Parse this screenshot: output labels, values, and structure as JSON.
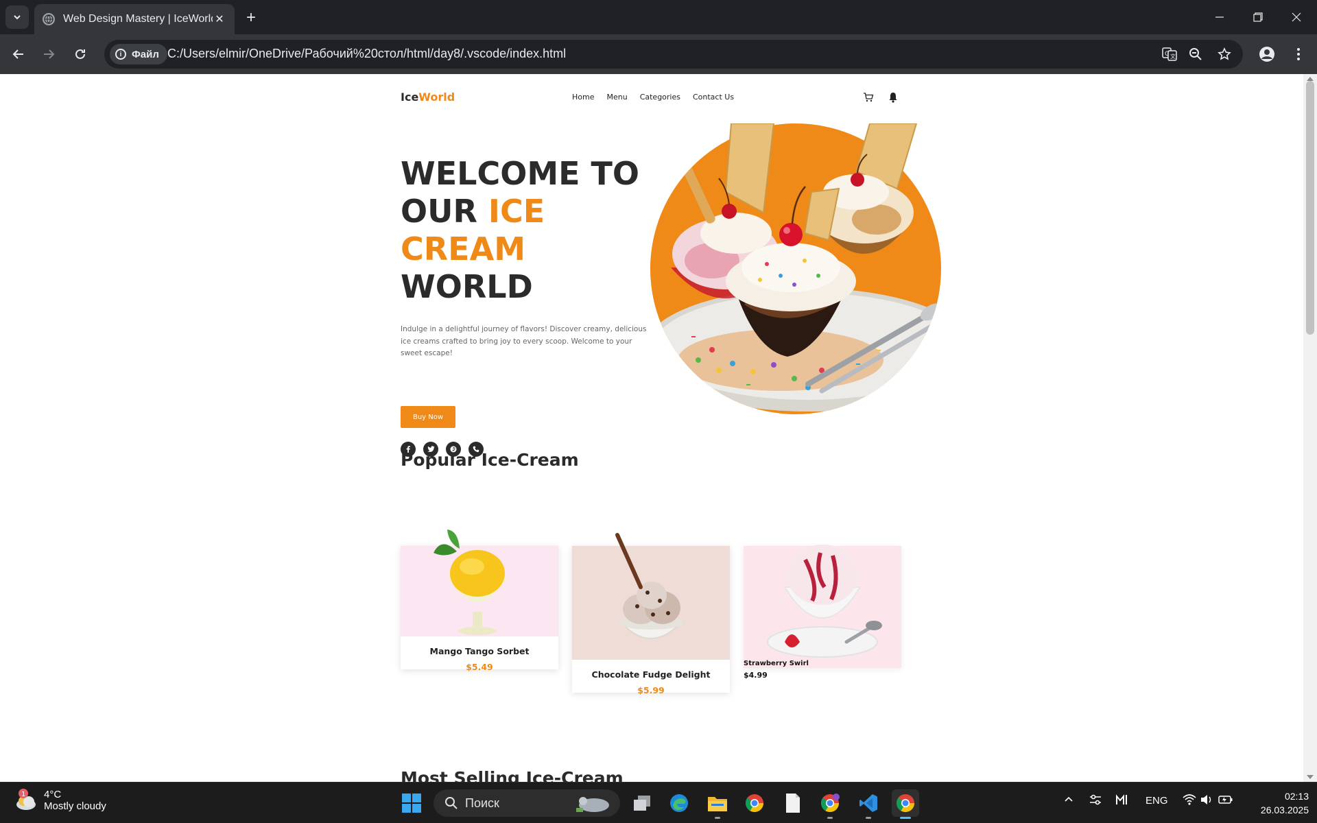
{
  "browser": {
    "tab_title": "Web Design Mastery | IceWorld",
    "site_info_label": "Файл",
    "url": "C:/Users/elmir/OneDrive/Рабочий%20стол/html/day8/.vscode/index.html"
  },
  "site": {
    "logo_part1": "Ice",
    "logo_part2": "World",
    "nav": [
      "Home",
      "Menu",
      "Categories",
      "Contact Us"
    ],
    "hero": {
      "title_line1": "WELCOME TO",
      "title_line2_a": "OUR ",
      "title_line2_b": "ICE CREAM",
      "title_line3": "WORLD",
      "description": "Indulge in a delightful journey of flavors! Discover creamy, delicious ice creams crafted to bring joy to every scoop. Welcome to your sweet escape!",
      "cta": "Buy Now"
    },
    "popular_title": "Popular Ice-Cream",
    "products": [
      {
        "name": "Mango Tango Sorbet",
        "price": "$5.49"
      },
      {
        "name": "Chocolate Fudge Delight",
        "price": "$5.99"
      },
      {
        "name": "Strawberry Swirl",
        "price": "$4.99"
      }
    ],
    "most_selling_title": "Most Selling Ice-Cream"
  },
  "taskbar": {
    "weather_temp": "4°C",
    "weather_cond": "Mostly cloudy",
    "weather_badge": "1",
    "search_placeholder": "Поиск",
    "lang": "ENG",
    "time": "02:13",
    "date": "26.03.2025"
  },
  "colors": {
    "accent": "#ef8a18",
    "dark_text": "#2b2b2b"
  },
  "icons": [
    "tab-list-icon",
    "globe-icon",
    "close-icon",
    "plus-icon",
    "minimize-icon",
    "restore-icon",
    "window-close-icon",
    "back-icon",
    "forward-icon",
    "reload-icon",
    "info-icon",
    "translate-icon",
    "zoom-icon",
    "star-icon",
    "profile-icon",
    "menu-dots-icon",
    "cart-icon",
    "bell-icon",
    "facebook-icon",
    "twitter-icon",
    "pinterest-icon",
    "phone-icon",
    "windows-start-icon",
    "search-icon"
  ]
}
